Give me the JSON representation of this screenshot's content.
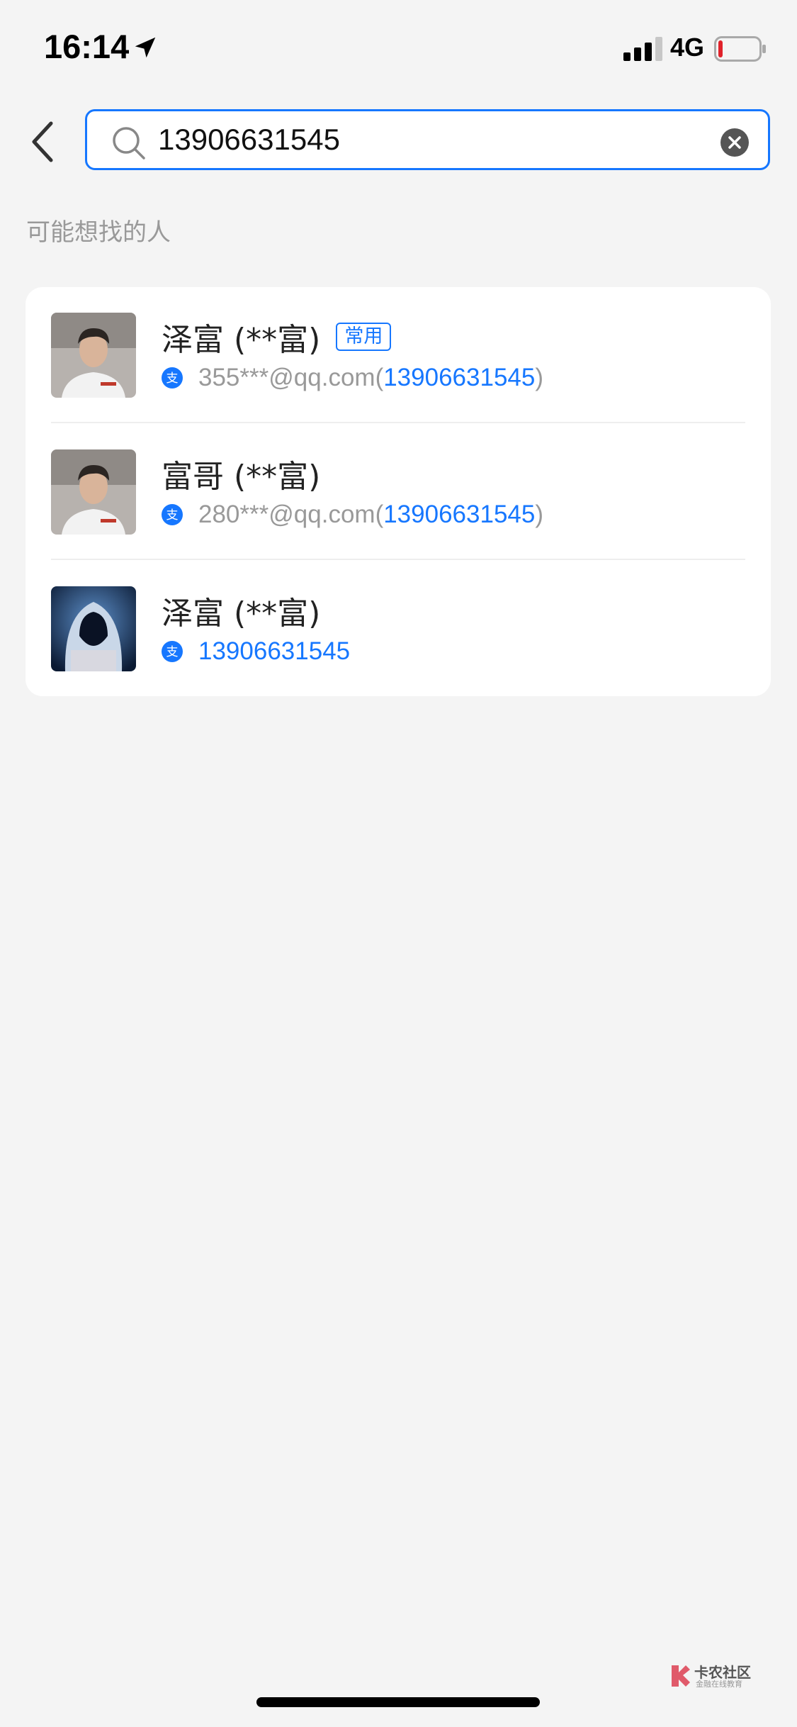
{
  "status_bar": {
    "time": "16:14",
    "network": "4G",
    "battery_level": 0.1
  },
  "search": {
    "query": "13906631545"
  },
  "section_title": "可能想找的人",
  "results": [
    {
      "name": "泽富 (**富)",
      "tag": "常用",
      "account_prefix": "355***@qq.com(",
      "phone": "13906631545",
      "account_suffix": ")",
      "avatar": "person-photo"
    },
    {
      "name": "富哥 (**富)",
      "tag": "",
      "account_prefix": "280***@qq.com(",
      "phone": "13906631545",
      "account_suffix": ")",
      "avatar": "person-photo"
    },
    {
      "name": "泽富 (**富)",
      "tag": "",
      "account_prefix": "",
      "phone": "13906631545",
      "account_suffix": "",
      "avatar": "hooded-figure"
    }
  ],
  "watermark": {
    "main": "卡农社区",
    "sub": "金融在线教育"
  },
  "colors": {
    "accent": "#1677ff",
    "background": "#f4f4f4",
    "card": "#ffffff",
    "muted_text": "#999999"
  }
}
